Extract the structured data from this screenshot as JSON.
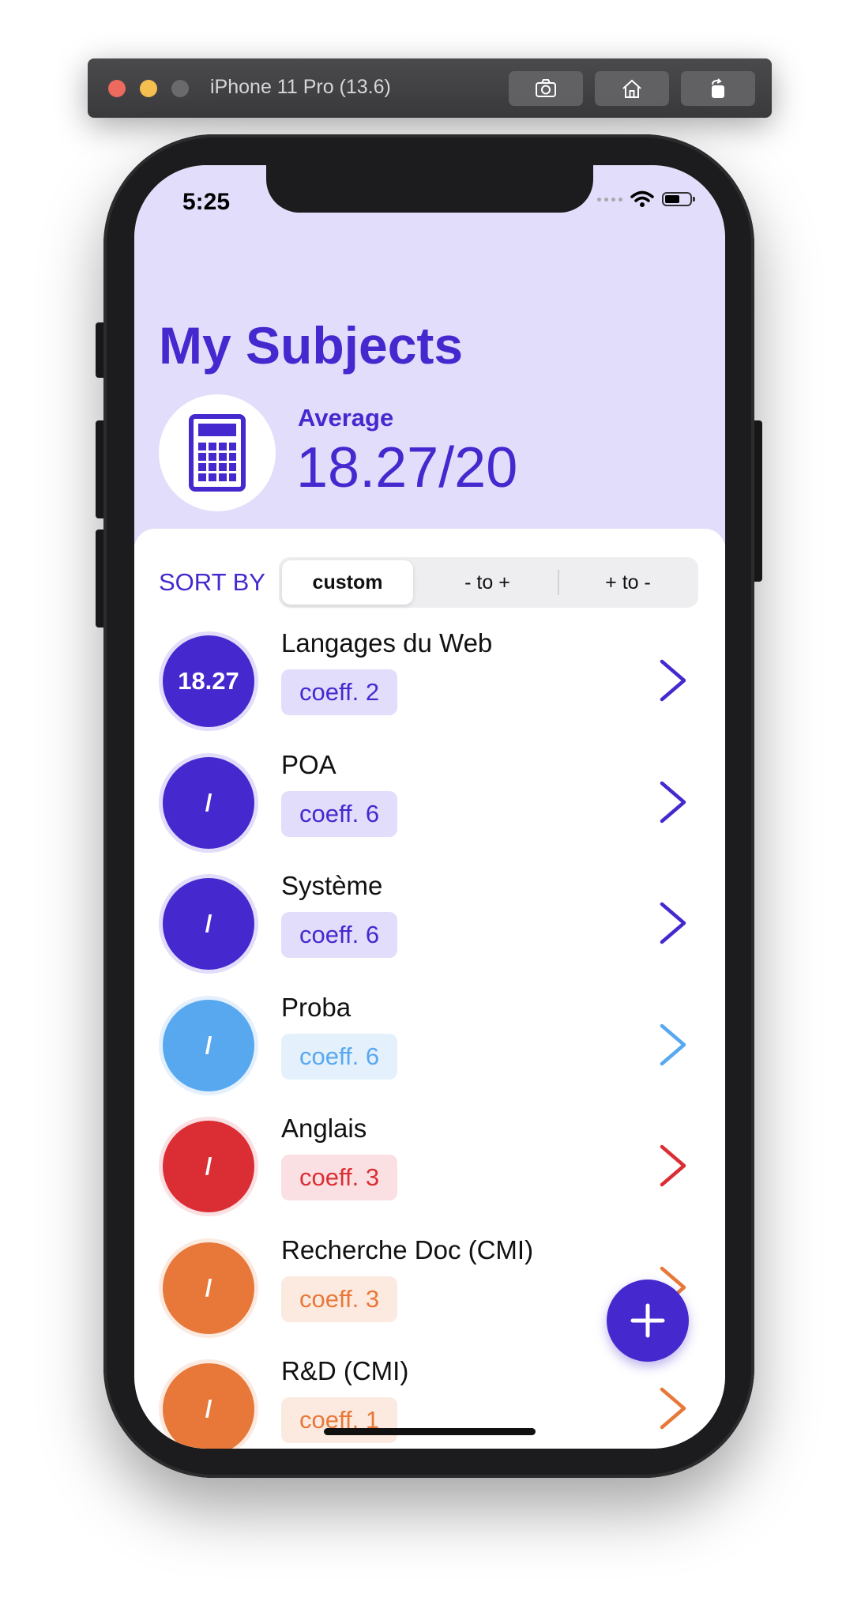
{
  "simulator": {
    "title": "iPhone 11 Pro (13.6)",
    "buttons": [
      "screenshot-icon",
      "home-icon",
      "rotate-icon"
    ]
  },
  "status_bar": {
    "time": "5:25"
  },
  "header": {
    "title": "My Subjects",
    "average_label": "Average",
    "average_value": "18.27/20"
  },
  "sort": {
    "label": "SORT BY",
    "options": [
      "custom",
      "- to +",
      "+ to -"
    ],
    "selected": "custom"
  },
  "subjects": [
    {
      "name": "Langages du Web",
      "grade": "18.27",
      "coeff": "coeff. 2",
      "color": "#4628cf",
      "tint": "#e2ddfa"
    },
    {
      "name": "POA",
      "grade": "/",
      "coeff": "coeff. 6",
      "color": "#4628cf",
      "tint": "#e2ddfa"
    },
    {
      "name": "Système",
      "grade": "/",
      "coeff": "coeff. 6",
      "color": "#4628cf",
      "tint": "#e2ddfa"
    },
    {
      "name": "Proba",
      "grade": "/",
      "coeff": "coeff. 6",
      "color": "#58a8f0",
      "tint": "#e4f1fd"
    },
    {
      "name": "Anglais",
      "grade": "/",
      "coeff": "coeff. 3",
      "color": "#db2e34",
      "tint": "#fae0e2"
    },
    {
      "name": "Recherche Doc (CMI)",
      "grade": "/",
      "coeff": "coeff. 3",
      "color": "#e8783a",
      "tint": "#fceae0"
    },
    {
      "name": "R&D (CMI)",
      "grade": "/",
      "coeff": "coeff. 1",
      "color": "#e8783a",
      "tint": "#fceae0"
    }
  ]
}
